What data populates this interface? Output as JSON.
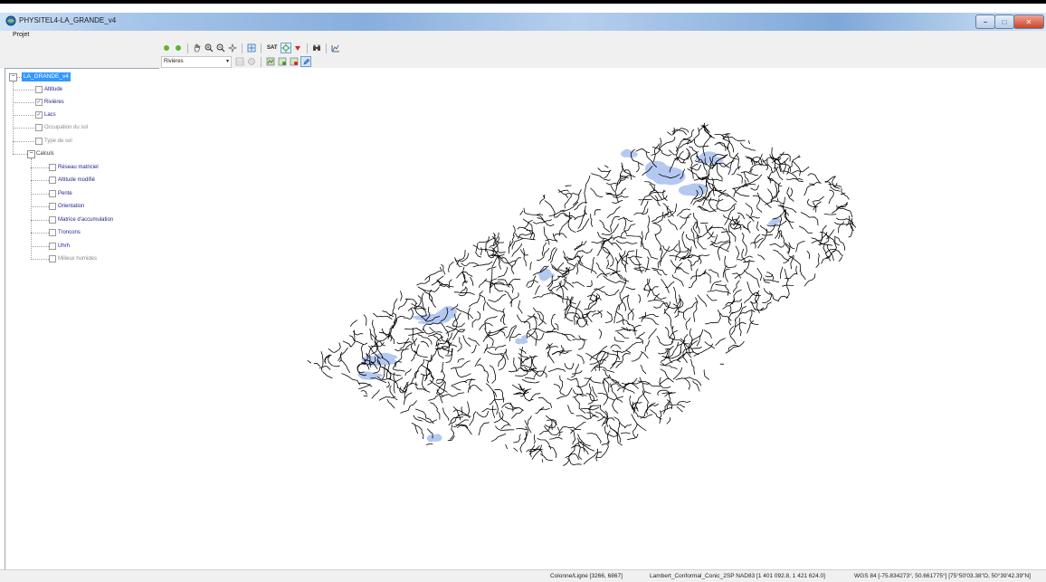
{
  "window": {
    "title": "PHYSITEL4-LA_GRANDE_v4",
    "min_symbol": "–",
    "max_symbol": "□",
    "close_symbol": "✕"
  },
  "menu": {
    "items": [
      "Projet"
    ]
  },
  "toolbar": {
    "sat_label": "SAT",
    "layer_select_value": "Rivières",
    "row1_icons": [
      "green-dot-icon",
      "green-dot-icon",
      "hand-pan-icon",
      "zoom-in-icon",
      "zoom-out-icon",
      "zoom-extent-icon",
      "fit-extent-icon",
      "sat-label",
      "pan-target-icon",
      "red-arrow-down-icon",
      "binoculars-icon",
      "elevation-icon"
    ],
    "row2_icons": [
      "layer-select",
      "table-icon",
      "circle-icon",
      "layers-add-icon",
      "layers-edit-icon",
      "layers-remove-icon",
      "pencil-edit-icon"
    ]
  },
  "tree": {
    "root": "LA_GRANDE_v4",
    "layers": [
      {
        "label": "Altitude",
        "checked": false,
        "enabled": true
      },
      {
        "label": "Rivières",
        "checked": true,
        "enabled": true
      },
      {
        "label": "Lacs",
        "checked": true,
        "enabled": true
      },
      {
        "label": "Occupation du sol",
        "checked": false,
        "enabled": false
      },
      {
        "label": "Type de sol",
        "checked": false,
        "enabled": false
      }
    ],
    "group": "Calculs",
    "calc_layers": [
      {
        "label": "Réseau matriciel",
        "enabled": true
      },
      {
        "label": "Altitude modifié",
        "enabled": true
      },
      {
        "label": "Pente",
        "enabled": true
      },
      {
        "label": "Orientation",
        "enabled": true
      },
      {
        "label": "Matrice d'accumulation",
        "enabled": true
      },
      {
        "label": "Troncons",
        "enabled": true
      },
      {
        "label": "Uhrh",
        "enabled": true
      },
      {
        "label": "Milieux humides",
        "enabled": false
      }
    ]
  },
  "map": {
    "river_color": "#000000",
    "lake_color": "#b4c8f2",
    "background": "#ffffff"
  },
  "status": {
    "row_col": "Colonne/Ligne [3266, 6867]",
    "projection": "Lambert_Conformal_Conic_2SP NAD83 [1 401 092.8, 1 421 624.0]",
    "wgs": "WGS 84 [-75.834273°, 50.661775°] [75°50'03.38\"O, 50°39'42.39\"N]"
  }
}
